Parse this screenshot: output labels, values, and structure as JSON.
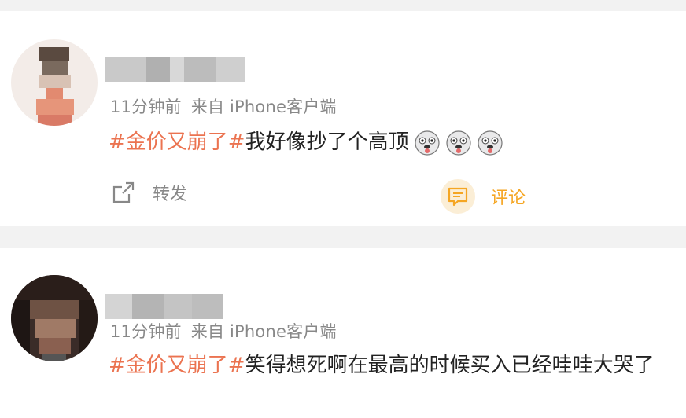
{
  "posts": [
    {
      "meta": {
        "time": "11分钟前",
        "source": "来自 iPhone客户端"
      },
      "content": {
        "hashtag": "#金价又崩了#",
        "text": "我好像抄了个高顶"
      },
      "emojis": [
        "doge-icon",
        "doge-icon",
        "doge-icon"
      ],
      "actions": {
        "repost": "转发",
        "comment": "评论"
      }
    },
    {
      "meta": {
        "time": "11分钟前",
        "source": "来自 iPhone客户端"
      },
      "content": {
        "hashtag": "#金价又崩了#",
        "text": "笑得想死啊在最高的时候买入已经哇哇大哭了"
      }
    }
  ],
  "colors": {
    "hashtag": "#eb7350",
    "comment_accent": "#f5a623",
    "meta": "#888888",
    "page_bg": "#f2f2f2"
  }
}
